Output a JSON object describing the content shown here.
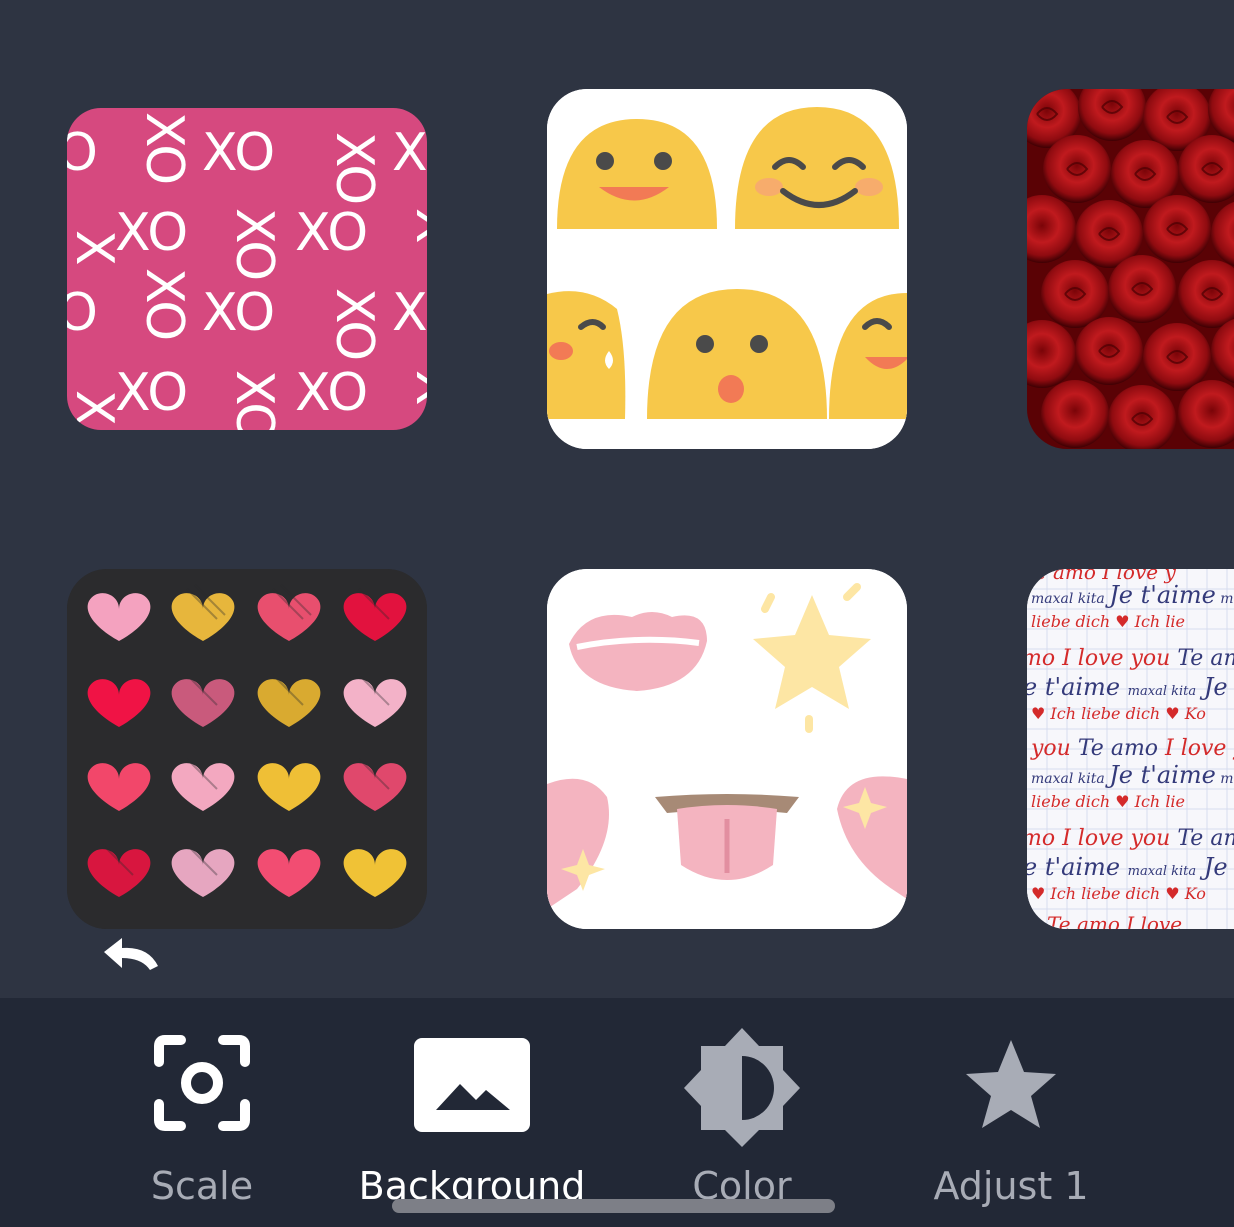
{
  "tiles": [
    {
      "name": "xo",
      "pattern_text": "XO",
      "color": "#d6497f"
    },
    {
      "name": "emoji-faces",
      "color": "#ffffff"
    },
    {
      "name": "red-roses",
      "color": "#9b0d12"
    },
    {
      "name": "scribble-hearts",
      "color": "#2b2b2d"
    },
    {
      "name": "kiss-star-tongue",
      "color": "#ffffff"
    },
    {
      "name": "love-languages",
      "phrases": [
        "Je t'aime",
        "I love you",
        "Te amo",
        "Ich liebe dich",
        "mahal kita"
      ]
    }
  ],
  "toolbar": {
    "items": [
      {
        "label": "Scale",
        "icon": "scale-focus-icon"
      },
      {
        "label": "Background",
        "icon": "image-landscape-icon",
        "active": true
      },
      {
        "label": "Color",
        "icon": "brightness-contrast-icon"
      },
      {
        "label": "Adjust 1",
        "icon": "star-icon"
      }
    ]
  },
  "colors": {
    "background": "#2e3442",
    "toolbar": "#222836",
    "label_inactive": "#a8acb6",
    "label_active": "#ffffff"
  }
}
